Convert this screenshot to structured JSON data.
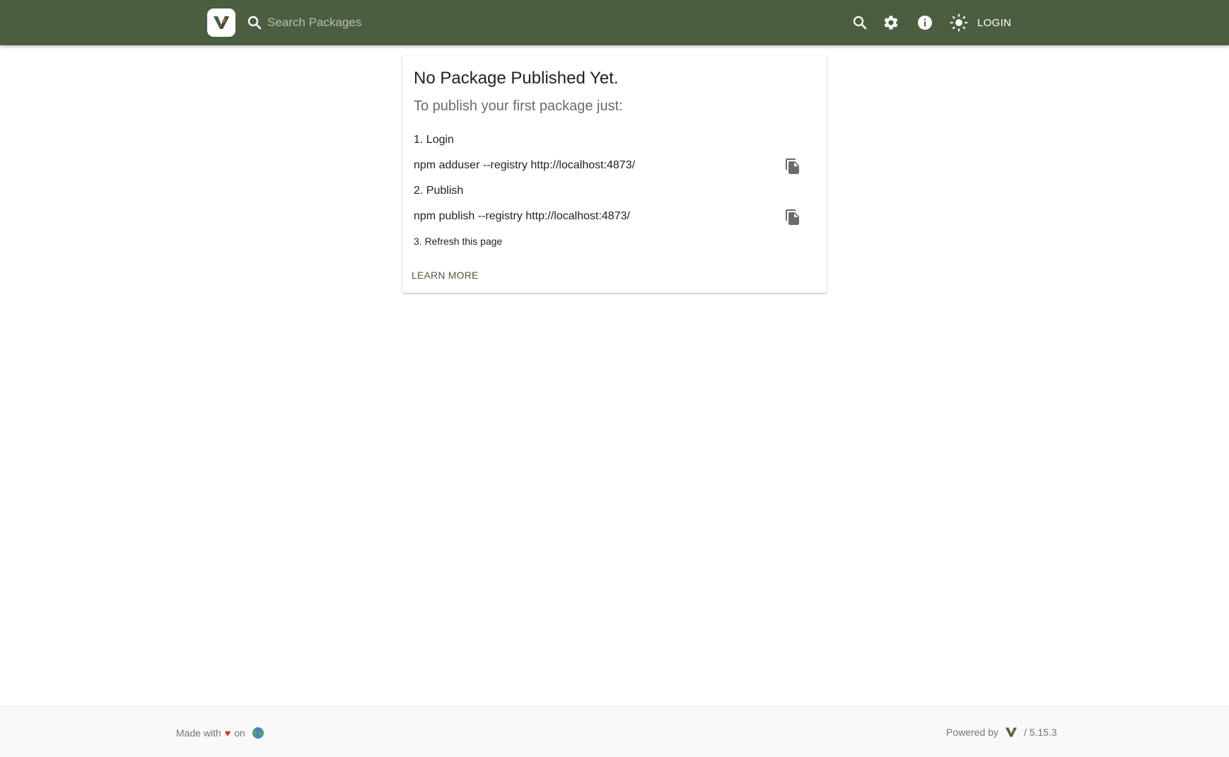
{
  "header": {
    "search": {
      "placeholder": "Search Packages",
      "value": ""
    },
    "login_label": "LOGIN",
    "icons": [
      "search-icon",
      "settings-gear-icon",
      "info-icon",
      "light-mode-sun-icon"
    ]
  },
  "card": {
    "title": "No Package Published Yet.",
    "subtitle": "To publish your first package just:",
    "step1": "1. Login",
    "cmd1": "npm adduser --registry http://localhost:4873/",
    "step2": "2. Publish",
    "cmd2": "npm publish --registry http://localhost:4873/",
    "step3": "3. Refresh this page",
    "learn_more": "LEARN MORE"
  },
  "footer": {
    "made_with": "Made with",
    "heart": "♥",
    "on": "on",
    "powered_by": "Powered by",
    "version": "/ 5.15.3"
  },
  "colors": {
    "header_bg": "#4b5e40",
    "accent": "#4b5e40",
    "heart": "#e0301e"
  }
}
